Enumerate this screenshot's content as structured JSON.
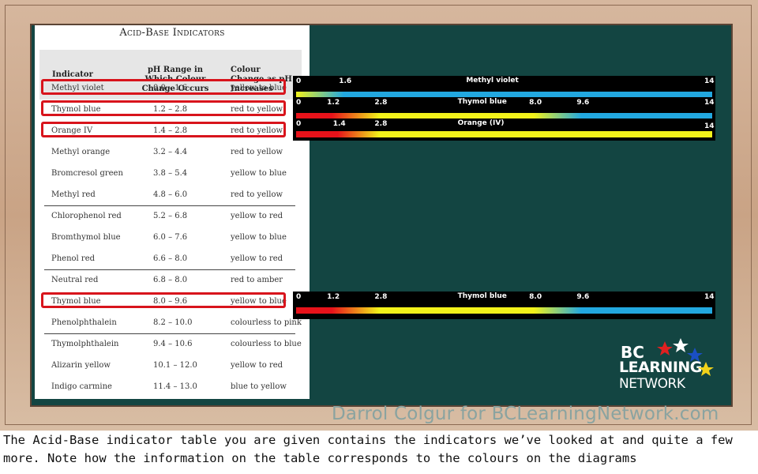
{
  "table": {
    "title": "Acid-Base Indicators",
    "headers": {
      "indicator": "Indicator",
      "ph_range": "pH Range in Which Colour Change Occurs",
      "colour_change": "Colour Change as pH Increases"
    },
    "rows": [
      {
        "indicator": "Methyl violet",
        "range": "0.0  –  1.6",
        "change": "yellow to blue",
        "highlighted": true
      },
      {
        "indicator": "Thymol blue",
        "range": "1.2  –  2.8",
        "change": "red to yellow",
        "highlighted": true
      },
      {
        "indicator": "Orange IV",
        "range": "1.4  –  2.8",
        "change": "red to yellow",
        "highlighted": true
      },
      {
        "indicator": "Methyl orange",
        "range": "3.2  –  4.4",
        "change": "red to yellow",
        "highlighted": false
      },
      {
        "indicator": "Bromcresol green",
        "range": "3.8  –  5.4",
        "change": "yellow to blue",
        "highlighted": false
      },
      {
        "indicator": "Methyl red",
        "range": "4.8  –  6.0",
        "change": "red to yellow",
        "highlighted": false
      },
      {
        "indicator": "Chlorophenol red",
        "range": "5.2  –  6.8",
        "change": "yellow to red",
        "highlighted": false
      },
      {
        "indicator": "Bromthymol blue",
        "range": "6.0  –  7.6",
        "change": "yellow to blue",
        "highlighted": false
      },
      {
        "indicator": "Phenol red",
        "range": "6.6  –  8.0",
        "change": "yellow to red",
        "highlighted": false
      },
      {
        "indicator": "Neutral red",
        "range": "6.8  –  8.0",
        "change": "red to amber",
        "highlighted": false
      },
      {
        "indicator": "Thymol blue",
        "range": "8.0  –  9.6",
        "change": "yellow to blue",
        "highlighted": true
      },
      {
        "indicator": "Phenolphthalein",
        "range": "8.2  –  10.0",
        "change": "colourless to pink",
        "highlighted": false
      },
      {
        "indicator": "Thymolphthalein",
        "range": "9.4  –  10.6",
        "change": "colourless to blue",
        "highlighted": false
      },
      {
        "indicator": "Alizarin yellow",
        "range": "10.1  –  12.0",
        "change": "yellow to red",
        "highlighted": false
      },
      {
        "indicator": "Indigo carmine",
        "range": "11.4  –  13.0",
        "change": "blue to yellow",
        "highlighted": false
      }
    ]
  },
  "scales": [
    {
      "name": "Methyl violet",
      "ticks": [
        "0",
        "1.6",
        "14"
      ],
      "tick_values": [
        0,
        1.6,
        14
      ],
      "transitions": [
        {
          "from": 0,
          "to": 1.6,
          "colour_start": "#f2f21a",
          "colour_end": "#22a8e0"
        }
      ],
      "start_colour": "#f2f21a",
      "end_colour": "#22a8e0"
    },
    {
      "name": "Thymol blue",
      "ticks": [
        "0",
        "1.2",
        "2.8",
        "8.0",
        "9.6",
        "14"
      ],
      "tick_values": [
        0,
        1.2,
        2.8,
        8.0,
        9.6,
        14
      ],
      "transitions": [
        {
          "from": 1.2,
          "to": 2.8,
          "colour_start": "#e8121a",
          "colour_end": "#f2f21a"
        },
        {
          "from": 8.0,
          "to": 9.6,
          "colour_start": "#f2f21a",
          "colour_end": "#22a8e0"
        }
      ],
      "start_colour": "#e8121a",
      "end_colour": "#22a8e0"
    },
    {
      "name": "Orange (IV)",
      "ticks": [
        "0",
        "1.4",
        "2.8",
        "14"
      ],
      "tick_values": [
        0,
        1.4,
        2.8,
        14
      ],
      "transitions": [
        {
          "from": 1.4,
          "to": 2.8,
          "colour_start": "#e8121a",
          "colour_end": "#f2f21a"
        }
      ],
      "start_colour": "#e8121a",
      "end_colour": "#f2f21a"
    },
    {
      "name": "Thymol blue",
      "ticks": [
        "0",
        "1.2",
        "2.8",
        "8.0",
        "9.6",
        "14"
      ],
      "tick_values": [
        0,
        1.2,
        2.8,
        8.0,
        9.6,
        14
      ],
      "transitions": [
        {
          "from": 1.2,
          "to": 2.8,
          "colour_start": "#e8121a",
          "colour_end": "#f2f21a"
        },
        {
          "from": 8.0,
          "to": 9.6,
          "colour_start": "#f2f21a",
          "colour_end": "#22a8e0"
        }
      ],
      "start_colour": "#e8121a",
      "end_colour": "#22a8e0"
    }
  ],
  "logo": {
    "line1": "BC",
    "line2": "LEARNING",
    "line3": "NETWORK"
  },
  "watermark": "Darrol Colgur for BCLearningNetwork.com",
  "caption": "The Acid-Base indicator table you are given contains the indicators we’ve looked at and quite a few more. Note how the information on the table corresponds to the colours on the diagrams",
  "colors": {
    "board": "#134542",
    "highlight": "#d8141c",
    "frame": "#cfae93"
  }
}
